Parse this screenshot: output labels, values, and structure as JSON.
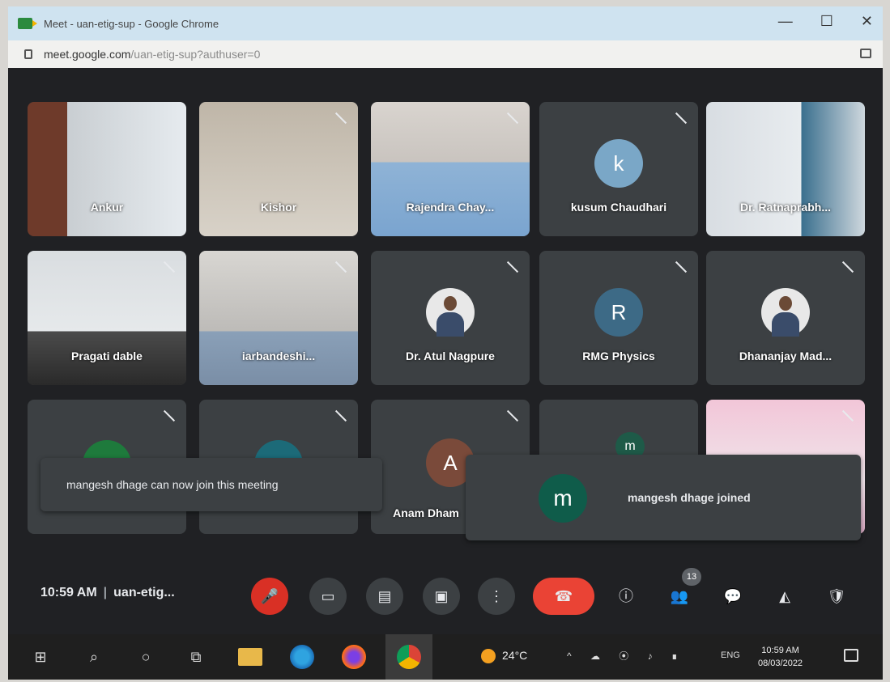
{
  "window": {
    "title": "Meet - uan-etig-sup - Google Chrome",
    "url_host": "meet.google.com",
    "url_path": "/uan-etig-sup?authuser=0",
    "controls": [
      "—",
      "☐",
      "✕"
    ]
  },
  "participants": [
    {
      "name": "Ankur",
      "avatar": ""
    },
    {
      "name": "Kishor",
      "avatar": ""
    },
    {
      "name": "Rajendra Chay...",
      "avatar": ""
    },
    {
      "name": "kusum Chaudhari",
      "avatar": "k"
    },
    {
      "name": "Dr. Ratnaprabh...",
      "avatar": ""
    },
    {
      "name": "Pragati dable",
      "avatar": ""
    },
    {
      "name": "iarbandeshi...",
      "avatar": ""
    },
    {
      "name": "Dr. Atul Nagpure",
      "avatar": ""
    },
    {
      "name": "RMG Physics",
      "avatar": "R"
    },
    {
      "name": "Dhananjay Mad...",
      "avatar": ""
    },
    {
      "name": "",
      "avatar": ""
    },
    {
      "name": "",
      "avatar": ""
    },
    {
      "name": "Anam Dham",
      "avatar": "A"
    },
    {
      "name": "",
      "avatar": "m"
    },
    {
      "name": "",
      "avatar": ""
    }
  ],
  "toasts": {
    "admit": "mangesh dhage can now join this meeting",
    "joined_avatar": "m",
    "joined": "mangesh dhage joined"
  },
  "bottombar": {
    "time": "10:59 AM",
    "separator": "|",
    "meeting_code": "uan-etig...",
    "people_count": "13"
  },
  "icons": {
    "mic_off": "🎤",
    "camera": "▭",
    "captions": "▤",
    "present": "▣",
    "more": "⋮",
    "hangup": "☎",
    "info": "ⓘ",
    "people": "👥",
    "chat": "💬",
    "activities": "◭",
    "host": "🛡"
  },
  "taskbar": {
    "start": "⊞",
    "search": "⌕",
    "cortana": "○",
    "taskview": "⧉",
    "temperature": "24°C",
    "tray": "^ ☁ ⦿ ♪ ∎",
    "language": "ENG",
    "time": "10:59 AM",
    "date": "08/03/2022"
  },
  "colors": {
    "meet_bg": "#202124",
    "tile_bg": "#3c4043",
    "mic_off_red": "#d93025",
    "hangup_red": "#ea4335",
    "titlebar": "#cfe3f0"
  }
}
